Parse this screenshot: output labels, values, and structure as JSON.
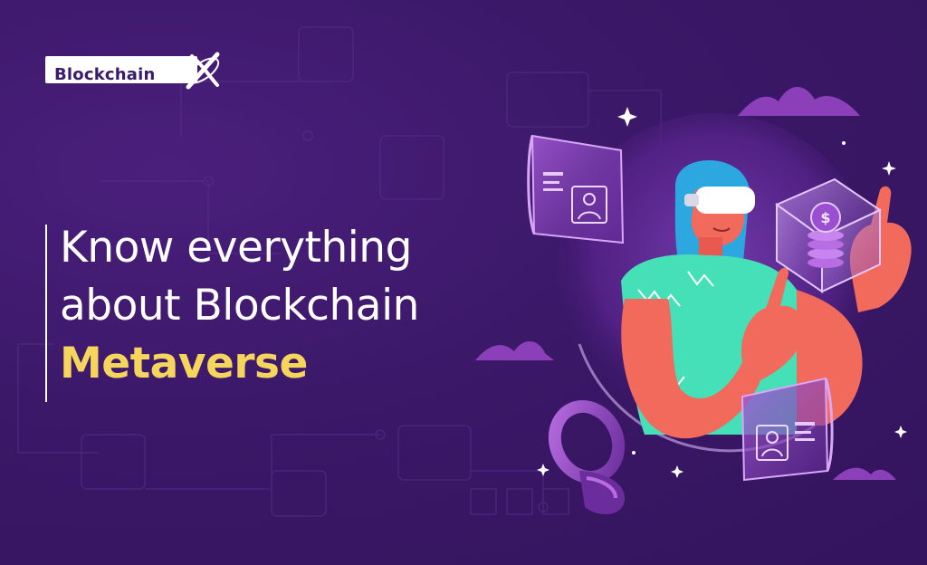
{
  "brand": {
    "name": "Blockchain",
    "mark_icon": "x-orbit-icon"
  },
  "headline": {
    "line1": "Know everything",
    "line2": "about Blockchain",
    "line3": "Metaverse"
  },
  "illustration": {
    "icons": [
      "vr-headset-person-illustration",
      "crypto-coin-cube-icon",
      "profile-card-icon",
      "vr-controller-icon",
      "sparkle-icon"
    ]
  },
  "colors": {
    "background": "#3a1666",
    "highlight": "#f6d55c",
    "shirt": "#45e0b8",
    "skin": "#f26a5c",
    "accent_purple": "#a24fd0"
  }
}
